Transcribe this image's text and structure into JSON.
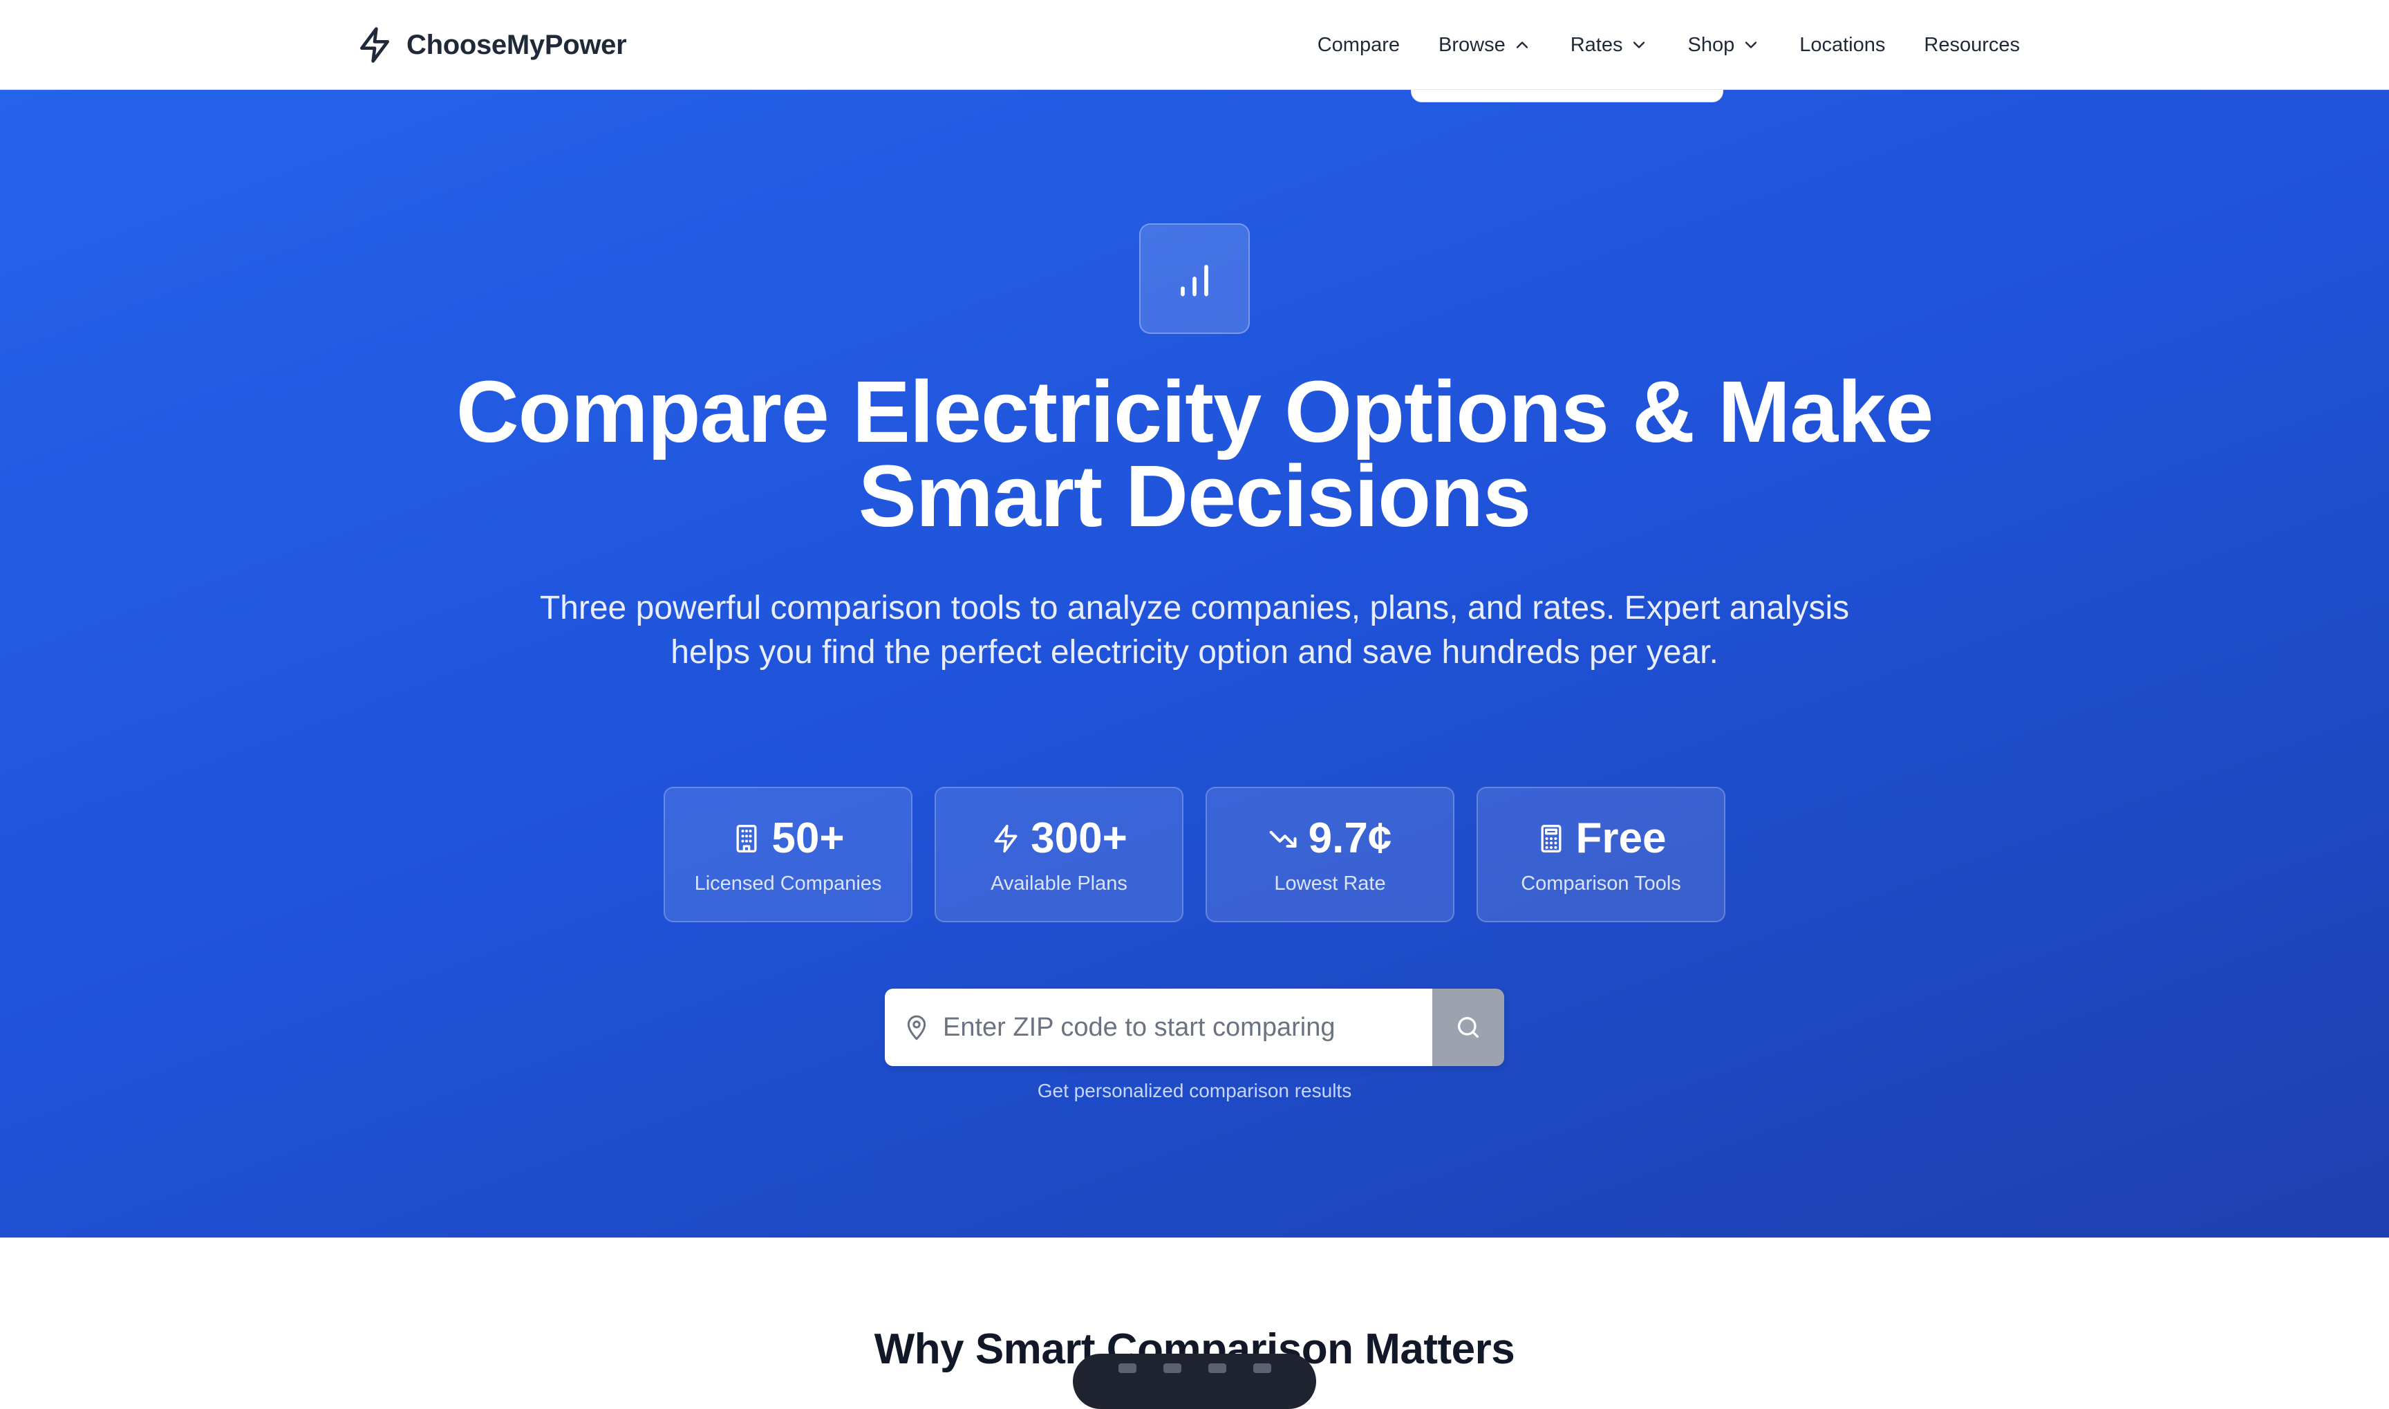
{
  "header": {
    "brand": "ChooseMyPower",
    "nav": [
      {
        "label": "Compare",
        "icon": ""
      },
      {
        "label": "Browse",
        "icon": "chevron-up-icon"
      },
      {
        "label": "Rates",
        "icon": "chevron-down-icon"
      },
      {
        "label": "Shop",
        "icon": "chevron-down-icon"
      },
      {
        "label": "Locations",
        "icon": ""
      },
      {
        "label": "Resources",
        "icon": ""
      }
    ]
  },
  "hero": {
    "badge_icon": "bar-chart-icon",
    "title_line1": "Compare Electricity Options & Make",
    "title_line2": "Smart Decisions",
    "subtitle": "Three powerful comparison tools to analyze companies, plans, and rates. Expert analysis helps you find the perfect electricity option and save hundreds per year.",
    "stats": [
      {
        "icon": "building-icon",
        "value": "50+",
        "label": "Licensed Companies"
      },
      {
        "icon": "lightning-icon",
        "value": "300+",
        "label": "Available Plans"
      },
      {
        "icon": "trending-down-icon",
        "value": "9.7¢",
        "label": "Lowest Rate"
      },
      {
        "icon": "calculator-icon",
        "value": "Free",
        "label": "Comparison Tools"
      }
    ],
    "search": {
      "placeholder": "Enter ZIP code to start comparing",
      "value": "",
      "leading_icon": "map-pin-icon",
      "button_icon": "search-icon",
      "helper": "Get personalized comparison results"
    }
  },
  "section": {
    "title": "Why Smart Comparison Matters"
  },
  "colors": {
    "hero_gradient_start": "#2563eb",
    "hero_gradient_end": "#1e40af",
    "brand_text": "#1f2937",
    "search_button": "#9ca3af"
  }
}
